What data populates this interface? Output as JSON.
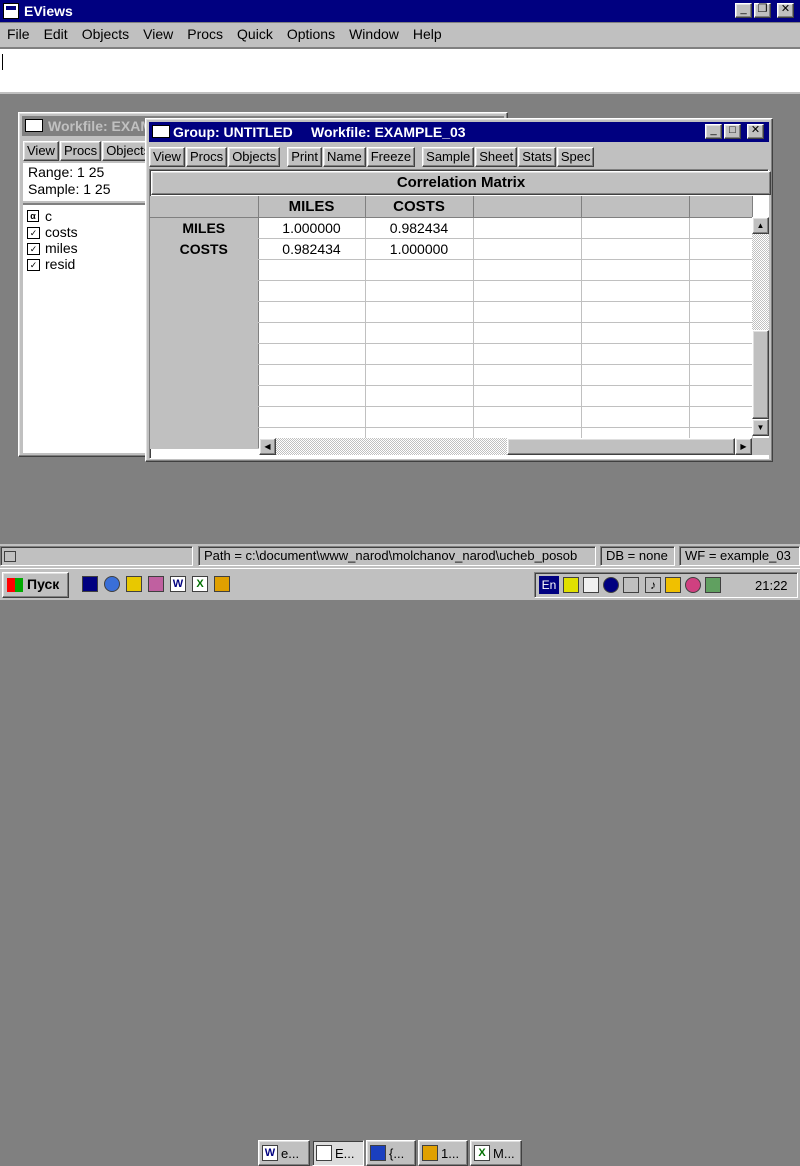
{
  "app": {
    "title": "EViews"
  },
  "menu": [
    "File",
    "Edit",
    "Objects",
    "View",
    "Procs",
    "Quick",
    "Options",
    "Window",
    "Help"
  ],
  "workfile": {
    "title": "Workfile: EXAMPLE_03",
    "toolbar": [
      "View",
      "Procs",
      "Objects"
    ],
    "range_label": "Range:",
    "range_value": "1 25",
    "sample_label": "Sample:",
    "sample_value": "1 25",
    "objects": [
      {
        "name": "c",
        "icon": "coef-icon"
      },
      {
        "name": "costs",
        "icon": "series-icon"
      },
      {
        "name": "miles",
        "icon": "series-icon"
      },
      {
        "name": "resid",
        "icon": "series-icon"
      }
    ]
  },
  "group": {
    "title": "Group: UNTITLED",
    "workfile_title": "Workfile: EXAMPLE_03",
    "toolbar1": [
      "View",
      "Procs",
      "Objects"
    ],
    "toolbar2": [
      "Print",
      "Name",
      "Freeze"
    ],
    "toolbar3": [
      "Sample",
      "Sheet",
      "Stats",
      "Spec"
    ],
    "table_title": "Correlation Matrix",
    "columns": [
      "MILES",
      "COSTS"
    ],
    "rows": [
      {
        "label": "MILES",
        "values": [
          "1.000000",
          "0.982434"
        ]
      },
      {
        "label": "COSTS",
        "values": [
          "0.982434",
          "1.000000"
        ]
      }
    ]
  },
  "statusbar": {
    "path": "Path = c:\\document\\www_narod\\molchanov_narod\\ucheb_posob",
    "db": "DB = none",
    "wf": "WF = example_03"
  },
  "taskbar": {
    "start": "Пуск",
    "tasks": [
      "e...",
      "E...",
      "{...",
      "1...",
      "M..."
    ],
    "lang": "En",
    "clock": "21:22"
  }
}
